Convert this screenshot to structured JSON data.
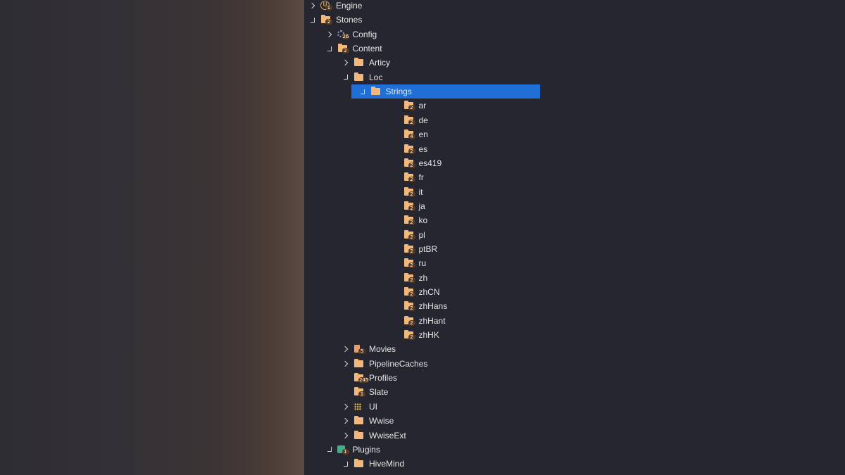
{
  "tree": {
    "items": [
      {
        "label": "Engine",
        "level": 0,
        "expander": "collapsed",
        "icon": "unreal-engine-icon",
        "badge": "1"
      },
      {
        "label": "Stones",
        "level": 0,
        "expander": "expanded",
        "icon": "folder-icon",
        "badge": "2"
      },
      {
        "label": "Config",
        "level": 1,
        "expander": "collapsed",
        "icon": "gear-folder-icon",
        "badge": "26"
      },
      {
        "label": "Content",
        "level": 1,
        "expander": "expanded",
        "icon": "folder-icon",
        "badge": "2"
      },
      {
        "label": "Articy",
        "level": 2,
        "expander": "collapsed",
        "icon": "folder-icon",
        "badge": ""
      },
      {
        "label": "Loc",
        "level": 2,
        "expander": "expanded",
        "icon": "folder-icon",
        "badge": ""
      },
      {
        "label": "Strings",
        "level": 3,
        "expander": "expanded",
        "icon": "folder-icon",
        "badge": "",
        "selected": true
      },
      {
        "label": "ar",
        "level": 5,
        "expander": "none",
        "icon": "folder-icon",
        "badge": "2"
      },
      {
        "label": "de",
        "level": 5,
        "expander": "none",
        "icon": "folder-icon",
        "badge": "2"
      },
      {
        "label": "en",
        "level": 5,
        "expander": "none",
        "icon": "folder-icon",
        "badge": "4"
      },
      {
        "label": "es",
        "level": 5,
        "expander": "none",
        "icon": "folder-icon",
        "badge": "2"
      },
      {
        "label": "es419",
        "level": 5,
        "expander": "none",
        "icon": "folder-icon",
        "badge": "2"
      },
      {
        "label": "fr",
        "level": 5,
        "expander": "none",
        "icon": "folder-icon",
        "badge": "2"
      },
      {
        "label": "it",
        "level": 5,
        "expander": "none",
        "icon": "folder-icon",
        "badge": "2"
      },
      {
        "label": "ja",
        "level": 5,
        "expander": "none",
        "icon": "folder-icon",
        "badge": "2"
      },
      {
        "label": "ko",
        "level": 5,
        "expander": "none",
        "icon": "folder-icon",
        "badge": "2"
      },
      {
        "label": "pl",
        "level": 5,
        "expander": "none",
        "icon": "folder-icon",
        "badge": "2"
      },
      {
        "label": "ptBR",
        "level": 5,
        "expander": "none",
        "icon": "folder-icon",
        "badge": "2"
      },
      {
        "label": "ru",
        "level": 5,
        "expander": "none",
        "icon": "folder-icon",
        "badge": "2"
      },
      {
        "label": "zh",
        "level": 5,
        "expander": "none",
        "icon": "folder-icon",
        "badge": "2"
      },
      {
        "label": "zhCN",
        "level": 5,
        "expander": "none",
        "icon": "folder-icon",
        "badge": "2"
      },
      {
        "label": "zhHans",
        "level": 5,
        "expander": "none",
        "icon": "folder-icon",
        "badge": "2"
      },
      {
        "label": "zhHant",
        "level": 5,
        "expander": "none",
        "icon": "folder-icon",
        "badge": "2"
      },
      {
        "label": "zhHK",
        "level": 5,
        "expander": "none",
        "icon": "folder-icon",
        "badge": "2"
      },
      {
        "label": "Movies",
        "level": 2,
        "expander": "collapsed",
        "icon": "movie-folder-icon",
        "badge": "5"
      },
      {
        "label": "PipelineCaches",
        "level": 2,
        "expander": "collapsed",
        "icon": "folder-icon",
        "badge": ""
      },
      {
        "label": "Profiles",
        "level": 2,
        "expander": "none",
        "icon": "folder-icon",
        "badge": "245"
      },
      {
        "label": "Slate",
        "level": 2,
        "expander": "none",
        "icon": "folder-icon",
        "badge": "1"
      },
      {
        "label": "UI",
        "level": 2,
        "expander": "collapsed",
        "icon": "grid-icon",
        "badge": ""
      },
      {
        "label": "Wwise",
        "level": 2,
        "expander": "collapsed",
        "icon": "folder-icon",
        "badge": ""
      },
      {
        "label": "WwiseExt",
        "level": 2,
        "expander": "collapsed",
        "icon": "folder-icon",
        "badge": ""
      },
      {
        "label": "Plugins",
        "level": 1,
        "expander": "expanded",
        "icon": "puzzle-icon",
        "badge": "1"
      },
      {
        "label": "HiveMind",
        "level": 2,
        "expander": "expanded",
        "icon": "folder-icon",
        "badge": ""
      }
    ]
  },
  "colors": {
    "background": "#25262f",
    "selection": "#1f6fd6",
    "folder": "#f2b77a",
    "text": "#e6e6e6"
  }
}
